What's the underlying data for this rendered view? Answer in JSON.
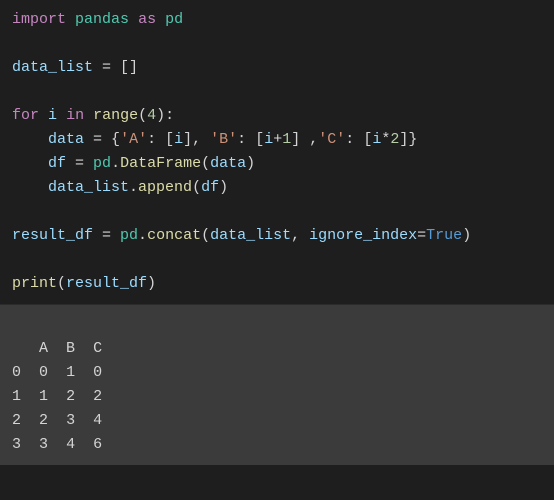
{
  "code": {
    "line1": {
      "kw_import": "import",
      "sp": " ",
      "mod_pandas": "pandas",
      "kw_as": "as",
      "mod_pd": "pd"
    },
    "line3": {
      "id_data_list": "data_list",
      "op_eq": " = ",
      "punc": "[]"
    },
    "line5": {
      "kw_for": "for",
      "sp": " ",
      "id_i": "i",
      "kw_in": "in",
      "fn_range": "range",
      "p_o": "(",
      "num4": "4",
      "p_c": ")",
      "colon": ":"
    },
    "line6": {
      "indent": "    ",
      "id_data": "data",
      "op_eq": " = ",
      "brace_o": "{",
      "str_A": "'A'",
      "colon1": ": ",
      "b1_o": "[",
      "id_i1": "i",
      "b1_c": "]",
      "comma1": ", ",
      "str_B": "'B'",
      "colon2": ": ",
      "b2_o": "[",
      "id_i2": "i",
      "plus": "+",
      "num1": "1",
      "b2_c": "]",
      "sp_comma": " ,",
      "str_C": "'C'",
      "colon3": ": ",
      "b3_o": "[",
      "id_i3": "i",
      "mul": "*",
      "num2": "2",
      "b3_c": "]",
      "brace_c": "}"
    },
    "line7": {
      "indent": "    ",
      "id_df": "df",
      "op_eq": " = ",
      "mod_pd": "pd",
      "dot": ".",
      "fn_DataFrame": "DataFrame",
      "p_o": "(",
      "id_data": "data",
      "p_c": ")"
    },
    "line8": {
      "indent": "    ",
      "id_data_list": "data_list",
      "dot": ".",
      "fn_append": "append",
      "p_o": "(",
      "id_df": "df",
      "p_c": ")"
    },
    "line10": {
      "id_result": "result_df",
      "op_eq": " = ",
      "mod_pd": "pd",
      "dot": ".",
      "fn_concat": "concat",
      "p_o": "(",
      "id_data_list": "data_list",
      "comma": ", ",
      "id_ignore": "ignore_index",
      "op_eq2": "=",
      "const_true": "True",
      "p_c": ")"
    },
    "line12": {
      "fn_print": "print",
      "p_o": "(",
      "id_result": "result_df",
      "p_c": ")"
    }
  },
  "output": {
    "header_pad": "   ",
    "cols": [
      "A",
      "B",
      "C"
    ],
    "rows": [
      {
        "idx": "0",
        "A": "0",
        "B": "1",
        "C": "0"
      },
      {
        "idx": "1",
        "A": "1",
        "B": "2",
        "C": "2"
      },
      {
        "idx": "2",
        "A": "2",
        "B": "3",
        "C": "4"
      },
      {
        "idx": "3",
        "A": "3",
        "B": "4",
        "C": "6"
      }
    ]
  },
  "chart_data": {
    "type": "table",
    "title": "result_df",
    "columns": [
      "A",
      "B",
      "C"
    ],
    "index": [
      0,
      1,
      2,
      3
    ],
    "data": [
      [
        0,
        1,
        0
      ],
      [
        1,
        2,
        2
      ],
      [
        2,
        3,
        4
      ],
      [
        3,
        4,
        6
      ]
    ]
  }
}
